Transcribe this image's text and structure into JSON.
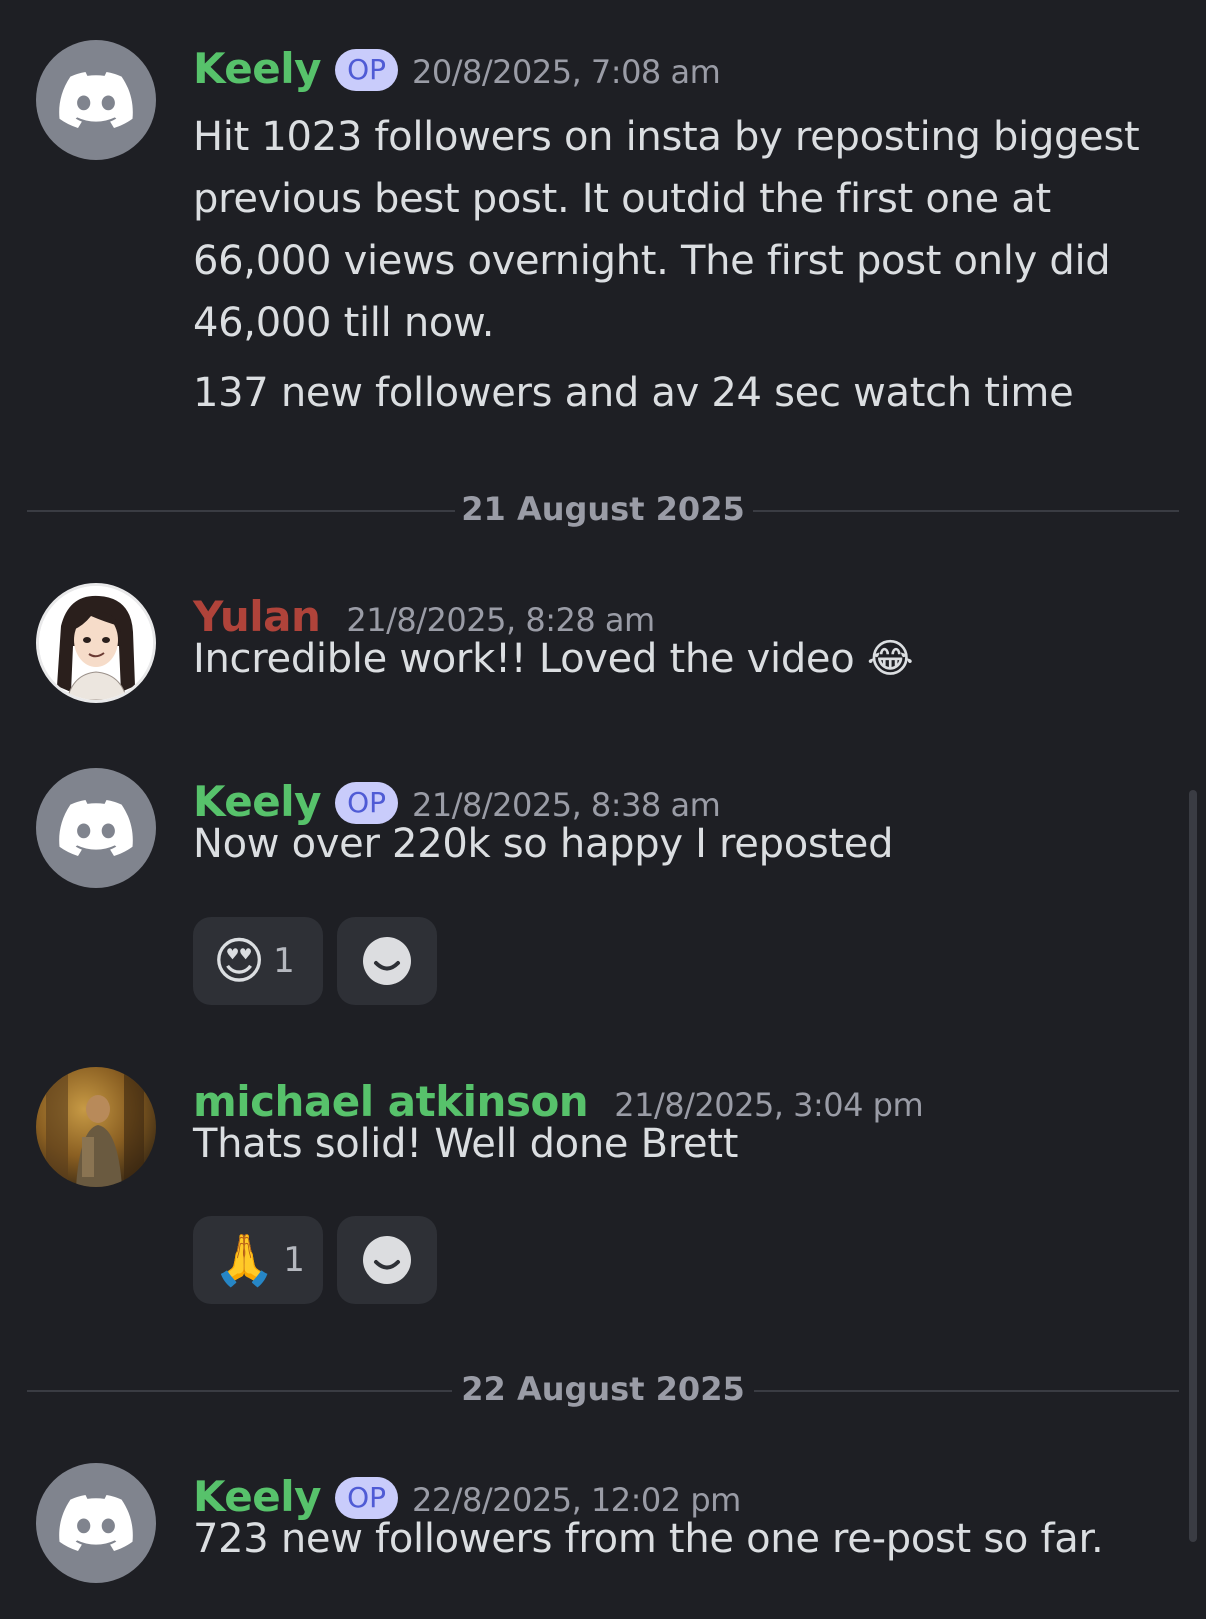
{
  "messages": [
    {
      "author": "Keely",
      "badge": "OP",
      "timestamp": "20/8/2025, 7:08 am",
      "lines": [
        "Hit 1023 followers on insta by reposting biggest previous best post. It outdid the first one at 66,000 views overnight. The first post only did 46,000 till now.",
        "137 new followers and av 24 sec watch time"
      ]
    },
    {
      "author": "Yulan",
      "timestamp": "21/8/2025, 8:28 am",
      "text": "Incredible work!! Loved the video",
      "emoji": "😂"
    },
    {
      "author": "Keely",
      "badge": "OP",
      "timestamp": "21/8/2025, 8:38 am",
      "text": "Now over 220k so happy I reposted",
      "reaction": {
        "emoji": "😍",
        "count": "1"
      }
    },
    {
      "author": "michael atkinson",
      "timestamp": "21/8/2025, 3:04 pm",
      "text": "Thats solid! Well done Brett",
      "reaction": {
        "emoji": "🙏",
        "count": "1"
      }
    },
    {
      "author": "Keely",
      "badge": "OP",
      "timestamp": "22/8/2025, 12:02 pm",
      "text": "723 new followers from the one re-post so far."
    }
  ],
  "dividers": [
    "21 August 2025",
    "22 August 2025"
  ],
  "icons": {
    "discord_avatar": "discord-logo-icon",
    "add_reaction": "smiley-icon"
  },
  "colors": {
    "background": "#1e1f24",
    "name_green": "#57c26b",
    "name_red": "#b0433a",
    "op_badge_bg": "#c9ccfb",
    "op_badge_text": "#4f5bd5",
    "reaction_bg": "#2e3036"
  }
}
